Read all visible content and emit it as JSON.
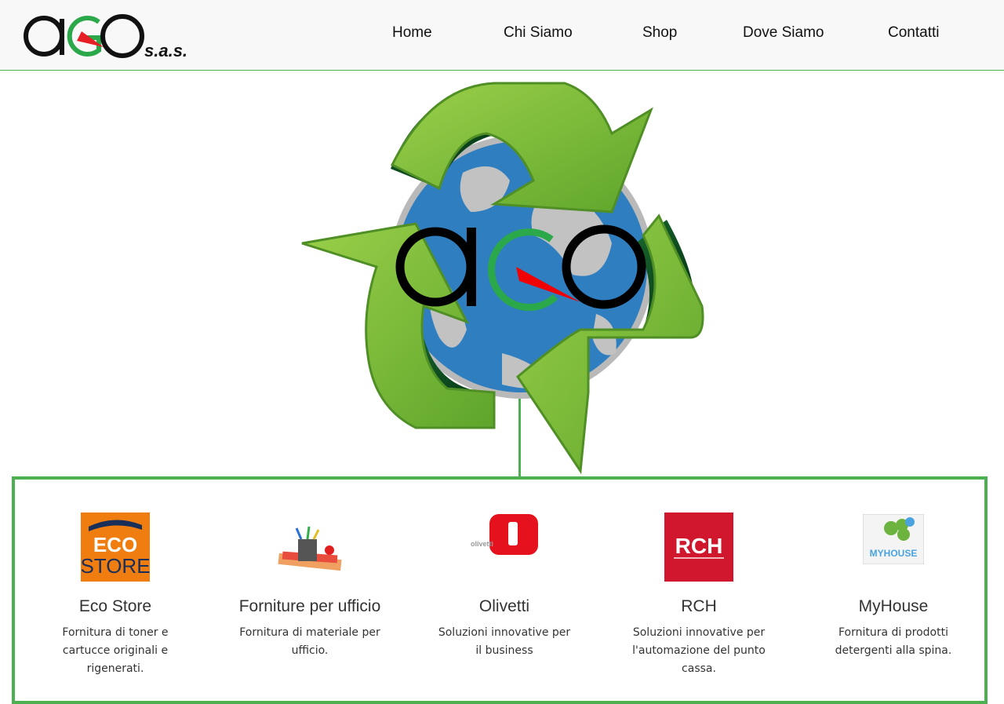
{
  "brand": {
    "logo_text": "aGO",
    "logo_suffix": "s.a.s."
  },
  "nav": [
    {
      "label": "Home"
    },
    {
      "label": "Chi Siamo"
    },
    {
      "label": "Shop"
    },
    {
      "label": "Dove Siamo"
    },
    {
      "label": "Contatti"
    }
  ],
  "hero": {
    "logo_text": "aGO",
    "icon": "recycle-globe-logo"
  },
  "colors": {
    "accent_green": "#4caf50",
    "header_bg": "#f8f8f8",
    "rch_red": "#d0172e",
    "eco_orange": "#ef7d0f",
    "olivetti_red": "#e5121d"
  },
  "services": [
    {
      "icon": "eco-store-logo",
      "logo_line1": "ECO",
      "logo_line2": "STORE",
      "title": "Eco Store",
      "description": "Fornitura di toner e cartucce originali e rigenerati."
    },
    {
      "icon": "office-supplies-icon",
      "title": "Forniture per ufficio",
      "description": "Fornitura di materiale per ufficio."
    },
    {
      "icon": "olivetti-logo",
      "logo_text": "olivetti",
      "title": "Olivetti",
      "description": "Soluzioni innovative per il business"
    },
    {
      "icon": "rch-logo",
      "logo_text": "RCH",
      "title": "RCH",
      "description": "Soluzioni innovative per l'automazione del punto cassa."
    },
    {
      "icon": "myhouse-logo",
      "logo_text": "MYHOUSE",
      "title": "MyHouse",
      "description": "Fornitura di prodotti detergenti alla spina."
    }
  ]
}
